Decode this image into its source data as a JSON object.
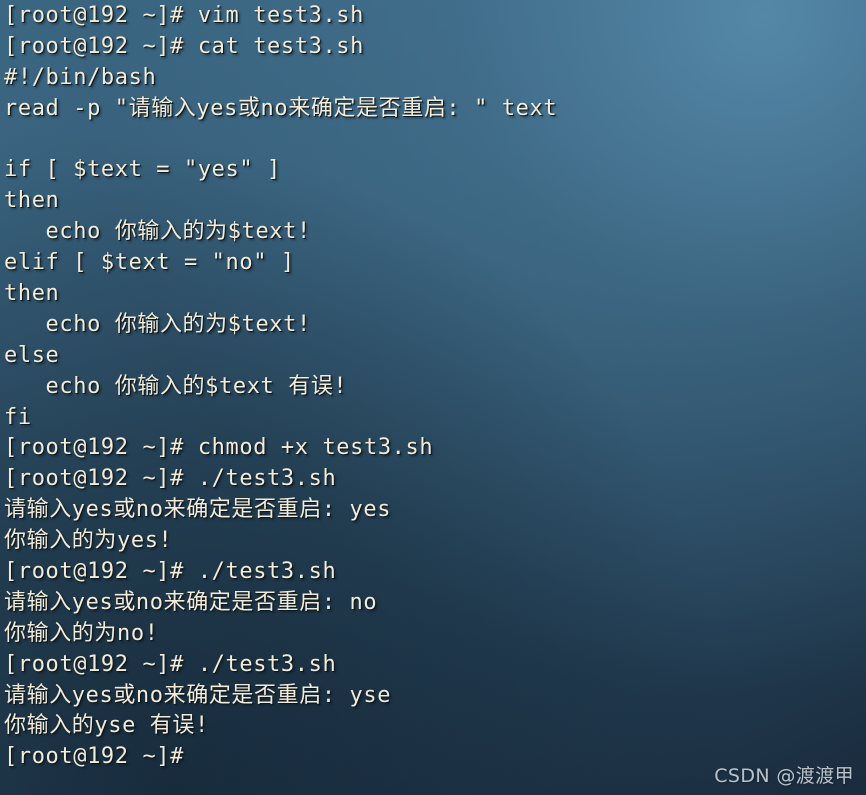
{
  "window": {
    "title": "root@192:~",
    "shell_prompt": "[root@192 ~]#",
    "colors": {
      "text": "#f2ecd9",
      "background_light": "#3d6a85",
      "background_dark": "#19293a",
      "watermark": "#e2e8ee"
    }
  },
  "console": {
    "lines": [
      {
        "id": "line-01",
        "text": "[root@192 ~]# vim test3.sh",
        "kind": "prompt-command"
      },
      {
        "id": "line-02",
        "text": "[root@192 ~]# cat test3.sh",
        "kind": "prompt-command"
      },
      {
        "id": "line-03",
        "text": "#!/bin/bash",
        "kind": "file-content"
      },
      {
        "id": "line-04",
        "text": "read -p \"请输入yes或no来确定是否重启: \" text",
        "kind": "file-content"
      },
      {
        "id": "line-05",
        "text": "",
        "kind": "blank"
      },
      {
        "id": "line-06",
        "text": "if [ $text = \"yes\" ]",
        "kind": "file-content"
      },
      {
        "id": "line-07",
        "text": "then",
        "kind": "file-content"
      },
      {
        "id": "line-08",
        "text": "   echo 你输入的为$text!",
        "kind": "file-content"
      },
      {
        "id": "line-09",
        "text": "elif [ $text = \"no\" ]",
        "kind": "file-content"
      },
      {
        "id": "line-10",
        "text": "then",
        "kind": "file-content"
      },
      {
        "id": "line-11",
        "text": "   echo 你输入的为$text!",
        "kind": "file-content"
      },
      {
        "id": "line-12",
        "text": "else",
        "kind": "file-content"
      },
      {
        "id": "line-13",
        "text": "   echo 你输入的$text 有误!",
        "kind": "file-content"
      },
      {
        "id": "line-14",
        "text": "fi",
        "kind": "file-content"
      },
      {
        "id": "line-15",
        "text": "[root@192 ~]# chmod +x test3.sh",
        "kind": "prompt-command"
      },
      {
        "id": "line-16",
        "text": "[root@192 ~]# ./test3.sh",
        "kind": "prompt-command"
      },
      {
        "id": "line-17",
        "text": "请输入yes或no来确定是否重启: yes",
        "kind": "program-output"
      },
      {
        "id": "line-18",
        "text": "你输入的为yes!",
        "kind": "program-output"
      },
      {
        "id": "line-19",
        "text": "[root@192 ~]# ./test3.sh",
        "kind": "prompt-command"
      },
      {
        "id": "line-20",
        "text": "请输入yes或no来确定是否重启: no",
        "kind": "program-output"
      },
      {
        "id": "line-21",
        "text": "你输入的为no!",
        "kind": "program-output"
      },
      {
        "id": "line-22",
        "text": "[root@192 ~]# ./test3.sh",
        "kind": "prompt-command"
      },
      {
        "id": "line-23",
        "text": "请输入yes或no来确定是否重启: yse",
        "kind": "program-output"
      },
      {
        "id": "line-24",
        "text": "你输入的yse 有误!",
        "kind": "program-output"
      },
      {
        "id": "line-25",
        "text": "[root@192 ~]#",
        "kind": "prompt-command"
      }
    ]
  },
  "watermark": {
    "text": "CSDN @渡渡甲"
  }
}
